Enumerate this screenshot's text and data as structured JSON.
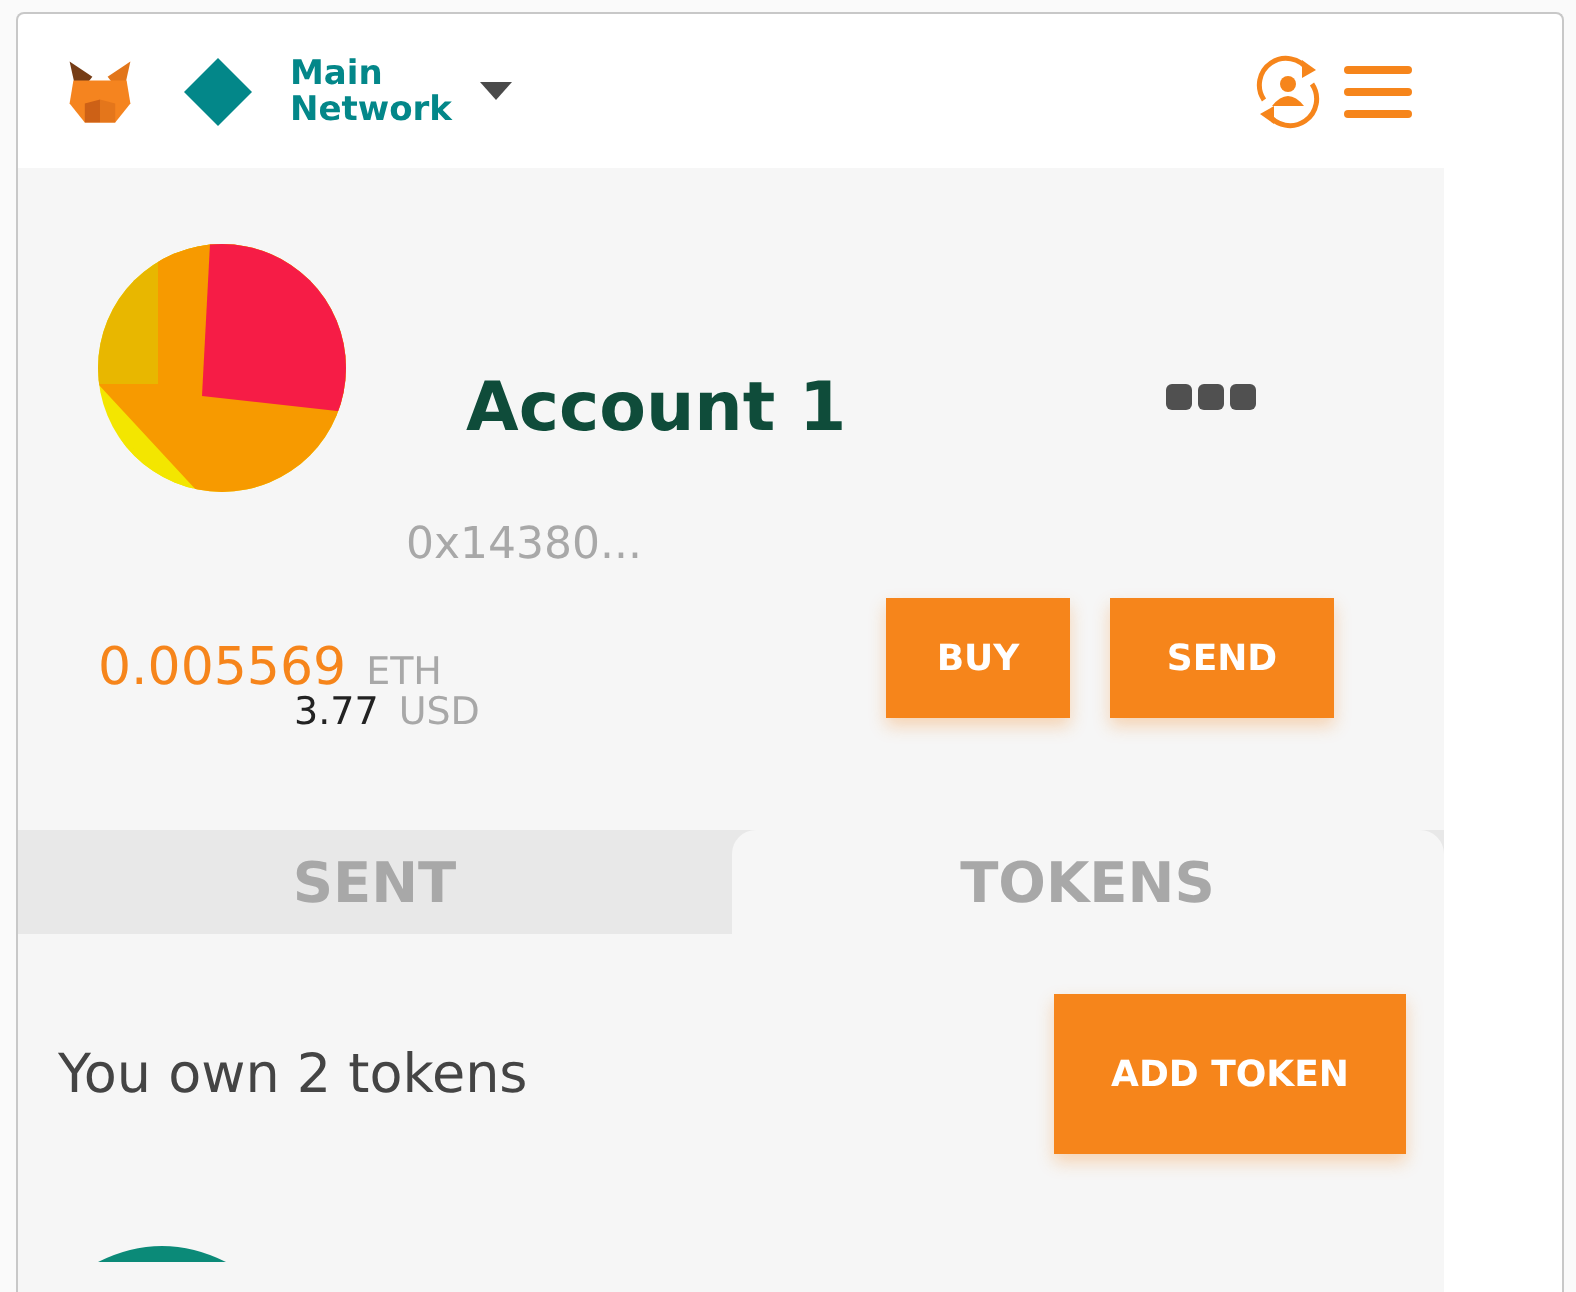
{
  "header": {
    "network": {
      "line_1": "Main",
      "line_2": "Network"
    }
  },
  "account": {
    "name": "Account 1",
    "address": "0x14380...",
    "balance": "0.005569",
    "balance_unit": "ETH",
    "fiat": "3.77",
    "fiat_unit": "USD"
  },
  "buttons": [
    "BUY",
    "SEND"
  ],
  "tabs": [
    {
      "label": "SENT",
      "selected": false
    },
    {
      "label": "TOKENS",
      "selected": true
    }
  ],
  "tokens": {
    "summary": "You own 2 tokens",
    "add_button": "ADD TOKEN"
  }
}
